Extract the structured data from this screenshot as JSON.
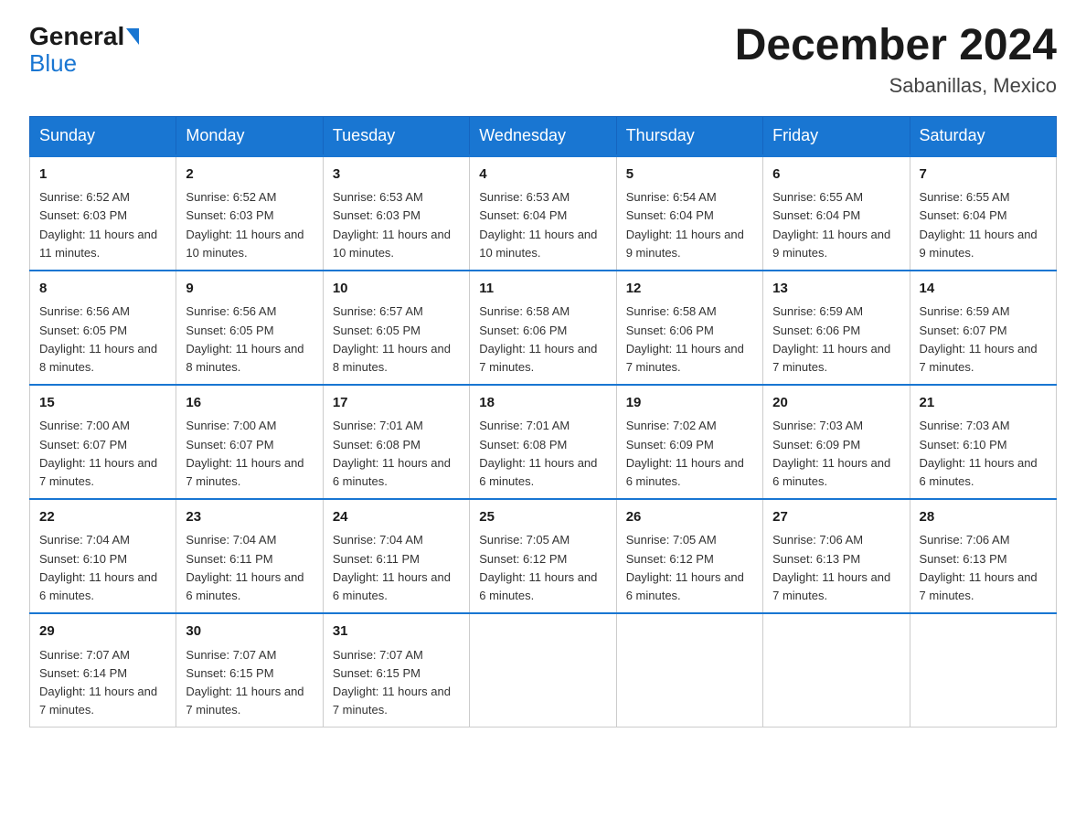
{
  "logo": {
    "general": "General",
    "blue": "Blue"
  },
  "title": {
    "month_year": "December 2024",
    "location": "Sabanillas, Mexico"
  },
  "headers": [
    "Sunday",
    "Monday",
    "Tuesday",
    "Wednesday",
    "Thursday",
    "Friday",
    "Saturday"
  ],
  "weeks": [
    [
      {
        "day": "1",
        "sunrise": "6:52 AM",
        "sunset": "6:03 PM",
        "daylight": "11 hours and 11 minutes."
      },
      {
        "day": "2",
        "sunrise": "6:52 AM",
        "sunset": "6:03 PM",
        "daylight": "11 hours and 10 minutes."
      },
      {
        "day": "3",
        "sunrise": "6:53 AM",
        "sunset": "6:03 PM",
        "daylight": "11 hours and 10 minutes."
      },
      {
        "day": "4",
        "sunrise": "6:53 AM",
        "sunset": "6:04 PM",
        "daylight": "11 hours and 10 minutes."
      },
      {
        "day": "5",
        "sunrise": "6:54 AM",
        "sunset": "6:04 PM",
        "daylight": "11 hours and 9 minutes."
      },
      {
        "day": "6",
        "sunrise": "6:55 AM",
        "sunset": "6:04 PM",
        "daylight": "11 hours and 9 minutes."
      },
      {
        "day": "7",
        "sunrise": "6:55 AM",
        "sunset": "6:04 PM",
        "daylight": "11 hours and 9 minutes."
      }
    ],
    [
      {
        "day": "8",
        "sunrise": "6:56 AM",
        "sunset": "6:05 PM",
        "daylight": "11 hours and 8 minutes."
      },
      {
        "day": "9",
        "sunrise": "6:56 AM",
        "sunset": "6:05 PM",
        "daylight": "11 hours and 8 minutes."
      },
      {
        "day": "10",
        "sunrise": "6:57 AM",
        "sunset": "6:05 PM",
        "daylight": "11 hours and 8 minutes."
      },
      {
        "day": "11",
        "sunrise": "6:58 AM",
        "sunset": "6:06 PM",
        "daylight": "11 hours and 7 minutes."
      },
      {
        "day": "12",
        "sunrise": "6:58 AM",
        "sunset": "6:06 PM",
        "daylight": "11 hours and 7 minutes."
      },
      {
        "day": "13",
        "sunrise": "6:59 AM",
        "sunset": "6:06 PM",
        "daylight": "11 hours and 7 minutes."
      },
      {
        "day": "14",
        "sunrise": "6:59 AM",
        "sunset": "6:07 PM",
        "daylight": "11 hours and 7 minutes."
      }
    ],
    [
      {
        "day": "15",
        "sunrise": "7:00 AM",
        "sunset": "6:07 PM",
        "daylight": "11 hours and 7 minutes."
      },
      {
        "day": "16",
        "sunrise": "7:00 AM",
        "sunset": "6:07 PM",
        "daylight": "11 hours and 7 minutes."
      },
      {
        "day": "17",
        "sunrise": "7:01 AM",
        "sunset": "6:08 PM",
        "daylight": "11 hours and 6 minutes."
      },
      {
        "day": "18",
        "sunrise": "7:01 AM",
        "sunset": "6:08 PM",
        "daylight": "11 hours and 6 minutes."
      },
      {
        "day": "19",
        "sunrise": "7:02 AM",
        "sunset": "6:09 PM",
        "daylight": "11 hours and 6 minutes."
      },
      {
        "day": "20",
        "sunrise": "7:03 AM",
        "sunset": "6:09 PM",
        "daylight": "11 hours and 6 minutes."
      },
      {
        "day": "21",
        "sunrise": "7:03 AM",
        "sunset": "6:10 PM",
        "daylight": "11 hours and 6 minutes."
      }
    ],
    [
      {
        "day": "22",
        "sunrise": "7:04 AM",
        "sunset": "6:10 PM",
        "daylight": "11 hours and 6 minutes."
      },
      {
        "day": "23",
        "sunrise": "7:04 AM",
        "sunset": "6:11 PM",
        "daylight": "11 hours and 6 minutes."
      },
      {
        "day": "24",
        "sunrise": "7:04 AM",
        "sunset": "6:11 PM",
        "daylight": "11 hours and 6 minutes."
      },
      {
        "day": "25",
        "sunrise": "7:05 AM",
        "sunset": "6:12 PM",
        "daylight": "11 hours and 6 minutes."
      },
      {
        "day": "26",
        "sunrise": "7:05 AM",
        "sunset": "6:12 PM",
        "daylight": "11 hours and 6 minutes."
      },
      {
        "day": "27",
        "sunrise": "7:06 AM",
        "sunset": "6:13 PM",
        "daylight": "11 hours and 7 minutes."
      },
      {
        "day": "28",
        "sunrise": "7:06 AM",
        "sunset": "6:13 PM",
        "daylight": "11 hours and 7 minutes."
      }
    ],
    [
      {
        "day": "29",
        "sunrise": "7:07 AM",
        "sunset": "6:14 PM",
        "daylight": "11 hours and 7 minutes."
      },
      {
        "day": "30",
        "sunrise": "7:07 AM",
        "sunset": "6:15 PM",
        "daylight": "11 hours and 7 minutes."
      },
      {
        "day": "31",
        "sunrise": "7:07 AM",
        "sunset": "6:15 PM",
        "daylight": "11 hours and 7 minutes."
      },
      null,
      null,
      null,
      null
    ]
  ],
  "labels": {
    "sunrise_prefix": "Sunrise: ",
    "sunset_prefix": "Sunset: ",
    "daylight_prefix": "Daylight: "
  }
}
